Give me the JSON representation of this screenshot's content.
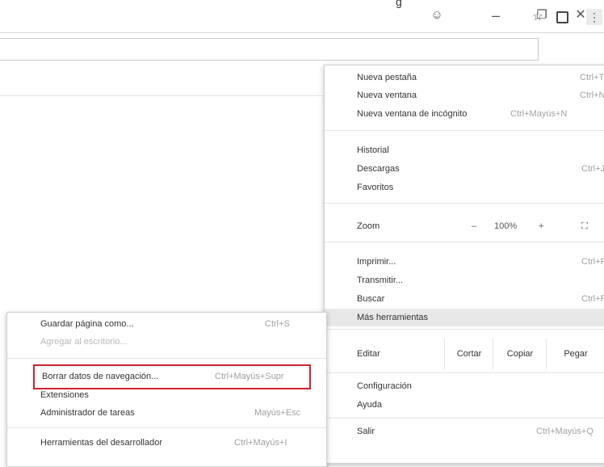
{
  "titlebar": {
    "partial_title": "g",
    "icons": {
      "profile": "profile-icon",
      "minimize": "minimize-icon",
      "restore": "restore-icon",
      "close": "close-icon"
    }
  },
  "toolbar": {
    "icons": {
      "bookmark": "star-icon",
      "extension": "extension-icon",
      "menu": "kebab-menu-icon"
    }
  },
  "main_menu": {
    "new_tab": {
      "label": "Nueva pestaña",
      "shortcut": "Ctrl+T"
    },
    "new_window": {
      "label": "Nueva ventana",
      "shortcut": "Ctrl+N"
    },
    "incognito": {
      "label": "Nueva ventana de incógnito",
      "shortcut": "Ctrl+Mayús+N"
    },
    "history": {
      "label": "Historial"
    },
    "downloads": {
      "label": "Descargas",
      "shortcut": "Ctrl+J"
    },
    "bookmarks": {
      "label": "Favoritos"
    },
    "zoom": {
      "label": "Zoom",
      "minus": "–",
      "value": "100%",
      "plus": "+",
      "fullscreen": "⛶"
    },
    "print": {
      "label": "Imprimir...",
      "shortcut": "Ctrl+P"
    },
    "cast": {
      "label": "Transmitir..."
    },
    "find": {
      "label": "Buscar",
      "shortcut": "Ctrl+F"
    },
    "more_tools": {
      "label": "Más herramientas"
    },
    "edit": {
      "label": "Editar",
      "cut": "Cortar",
      "copy": "Copiar",
      "paste": "Pegar"
    },
    "settings": {
      "label": "Configuración"
    },
    "help": {
      "label": "Ayuda"
    },
    "exit": {
      "label": "Salir",
      "shortcut": "Ctrl+Mayús+Q"
    }
  },
  "sub_menu": {
    "save_page": {
      "label": "Guardar página como...",
      "shortcut": "Ctrl+S"
    },
    "add_desktop": {
      "label": "Agregar al escritorio..."
    },
    "clear_data": {
      "label": "Borrar datos de navegación...",
      "shortcut": "Ctrl+Mayús+Supr"
    },
    "extensions": {
      "label": "Extensiones"
    },
    "task_manager": {
      "label": "Administrador de tareas",
      "shortcut": "Mayús+Esc"
    },
    "dev_tools": {
      "label": "Herramientas del desarrollador",
      "shortcut": "Ctrl+Mayús+I"
    }
  },
  "highlight_color": "#d0222c"
}
